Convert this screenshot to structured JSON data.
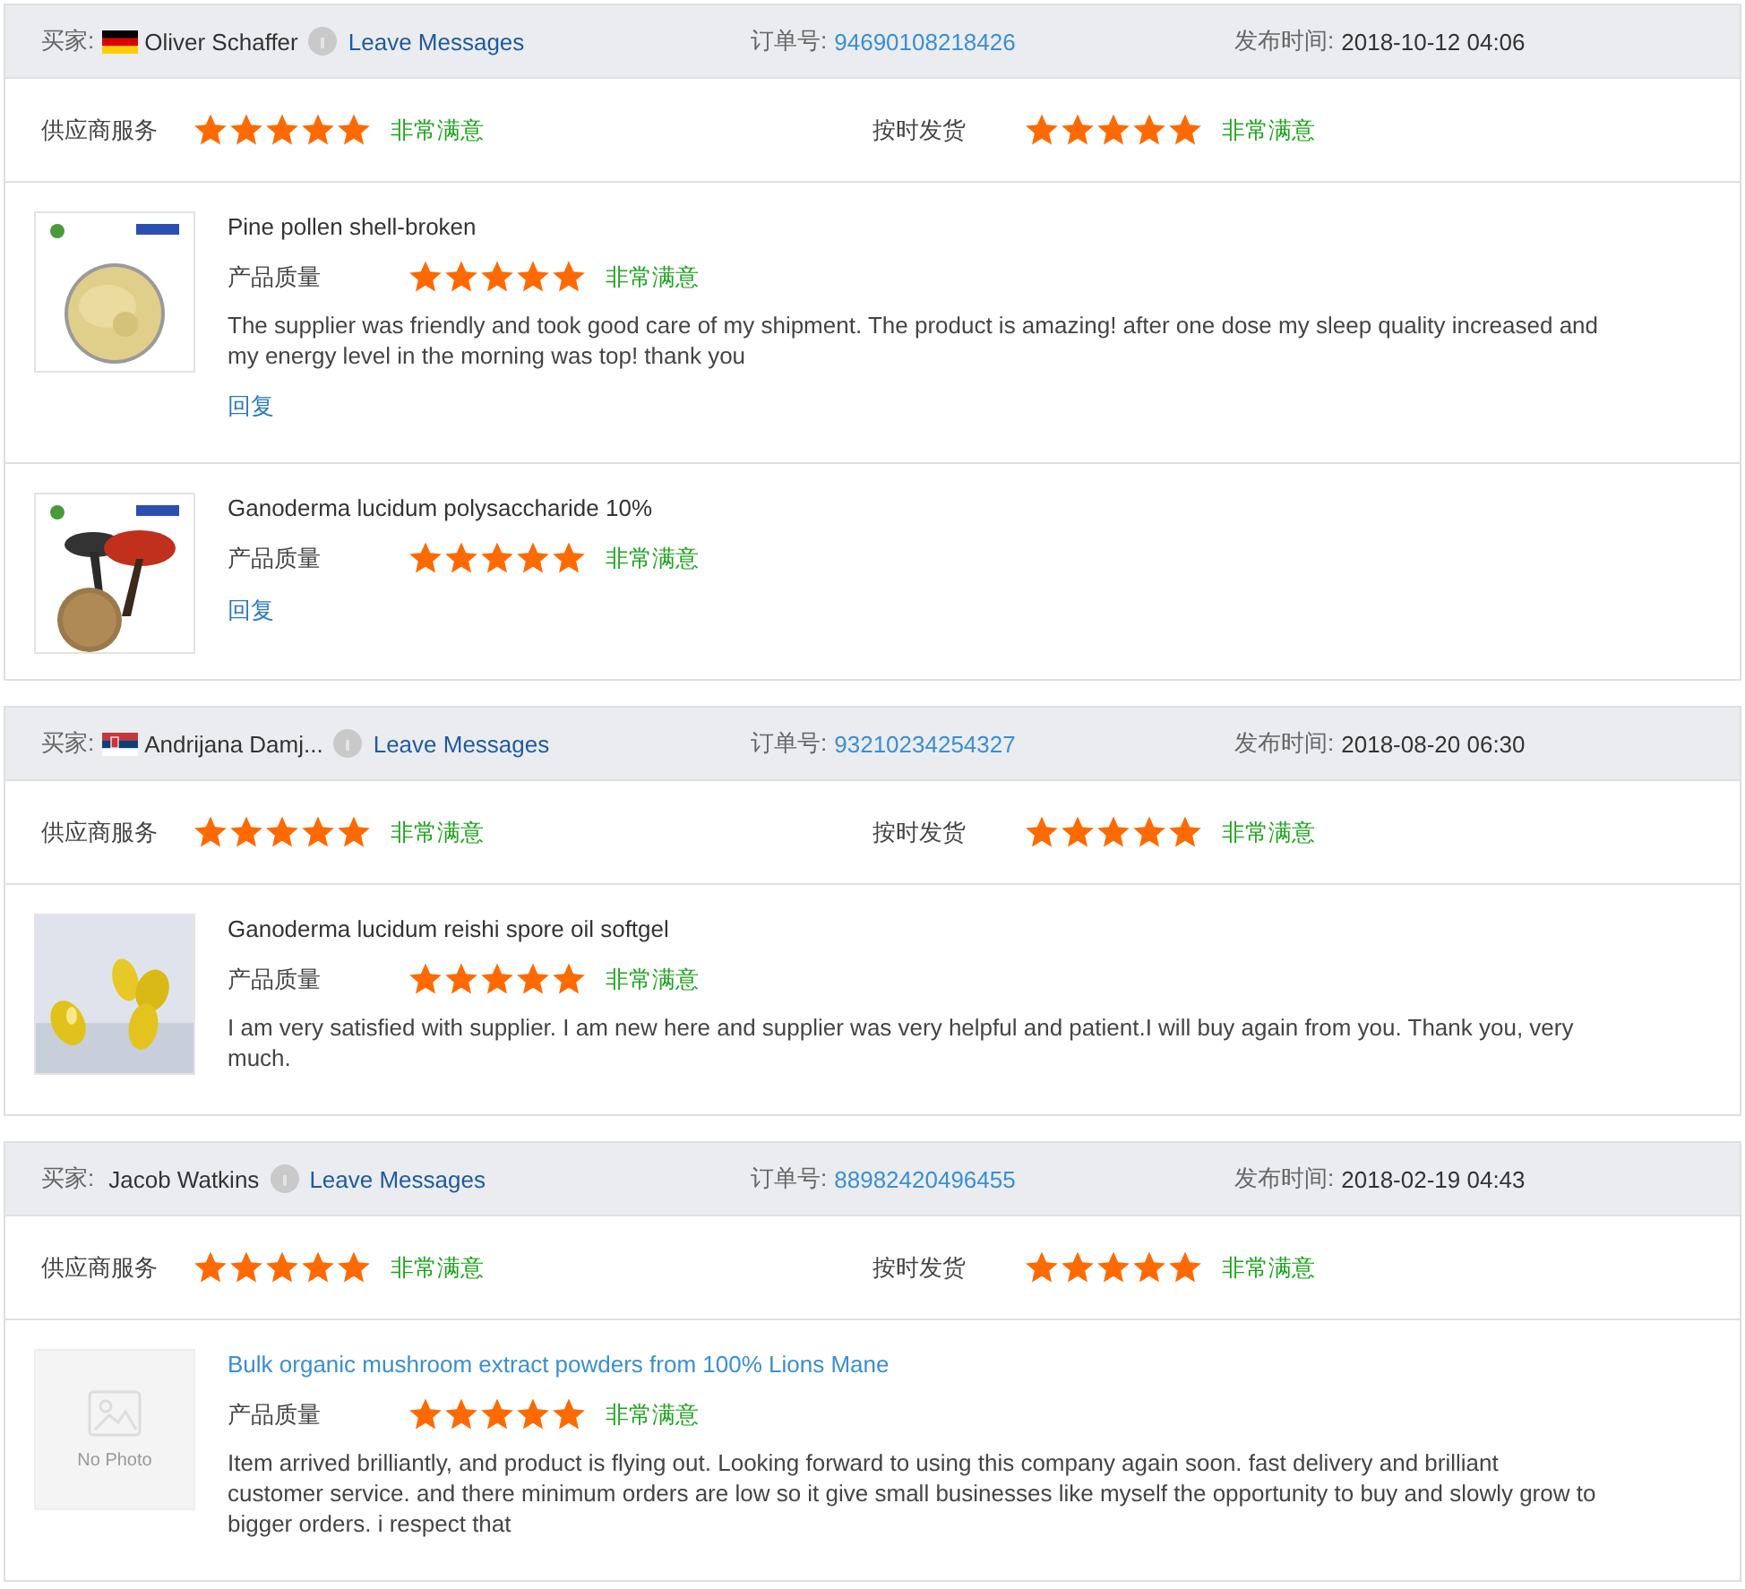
{
  "reviews": [
    {
      "buyer_label": "买家:",
      "flag": {
        "kind": "germany"
      },
      "buyer": "Oliver Schaffer",
      "message_link": "Leave Messages",
      "order_label": "订单号:",
      "order_no": "94690108218426",
      "date_label": "发布时间:",
      "date": "2018-10-12 04:06",
      "ratings": [
        {
          "label": "供应商服务",
          "stars": 5,
          "verdict": "非常满意"
        },
        {
          "label": "按时发货",
          "stars": 5,
          "verdict": "非常满意"
        }
      ],
      "products": [
        {
          "title": "Pine pollen shell-broken",
          "linked": false,
          "quality_label": "产品质量",
          "stars": 5,
          "verdict": "非常满意",
          "comment": "The supplier was friendly and took good care of my shipment. The product is amazing! after one dose my sleep quality increased and my energy level in the morning was top! thank you",
          "reply": "回复"
        },
        {
          "title": "Ganoderma lucidum polysaccharide 10%",
          "linked": false,
          "quality_label": "产品质量",
          "stars": 5,
          "verdict": "非常满意",
          "reply": "回复"
        }
      ]
    },
    {
      "buyer_label": "买家:",
      "flag": {
        "kind": "serbia"
      },
      "buyer": "Andrijana Damj...",
      "message_link": "Leave Messages",
      "order_label": "订单号:",
      "order_no": "93210234254327",
      "date_label": "发布时间:",
      "date": "2018-08-20 06:30",
      "ratings": [
        {
          "label": "供应商服务",
          "stars": 5,
          "verdict": "非常满意"
        },
        {
          "label": "按时发货",
          "stars": 5,
          "verdict": "非常满意"
        }
      ],
      "products": [
        {
          "title": "Ganoderma lucidum reishi spore oil softgel",
          "linked": false,
          "quality_label": "产品质量",
          "stars": 5,
          "verdict": "非常满意",
          "comment": "I am very satisfied with supplier. I am new here and supplier was very helpful and patient.I will buy again from you. Thank you, very much."
        }
      ]
    },
    {
      "buyer_label": "买家:",
      "buyer": "Jacob Watkins",
      "message_link": "Leave Messages",
      "order_label": "订单号:",
      "order_no": "88982420496455",
      "date_label": "发布时间:",
      "date": "2018-02-19 04:43",
      "ratings": [
        {
          "label": "供应商服务",
          "stars": 5,
          "verdict": "非常满意"
        },
        {
          "label": "按时发货",
          "stars": 5,
          "verdict": "非常满意"
        }
      ],
      "products": [
        {
          "image": {
            "kind": "no_photo",
            "caption": "No Photo"
          },
          "title": "Bulk organic mushroom extract powders from 100% Lions Mane",
          "linked": true,
          "quality_label": "产品质量",
          "stars": 5,
          "verdict": "非常满意",
          "comment": "Item arrived brilliantly, and product is flying out. Looking forward to using this company again soon. fast delivery and brilliant customer service. and there minimum orders are low so it give small businesses like myself the opportunity to buy and slowly grow to bigger orders. i respect that"
        }
      ]
    }
  ]
}
